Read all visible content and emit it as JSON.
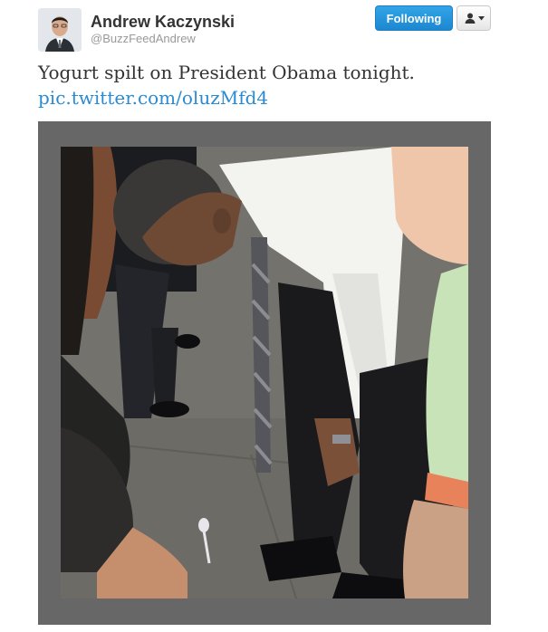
{
  "author": {
    "display_name": "Andrew Kaczynski",
    "handle": "@BuzzFeedAndrew",
    "avatar_icon": "user-avatar"
  },
  "actions": {
    "follow_label": "Following",
    "user_menu_icon": "person-dropdown-icon"
  },
  "tweet": {
    "text": "Yogurt spilt on President Obama tonight.",
    "link": "pic.twitter.com/oluzMfd4"
  },
  "colors": {
    "link": "#2a8bd2",
    "follow_button": "#1b87d1",
    "media_frame": "#676767"
  }
}
